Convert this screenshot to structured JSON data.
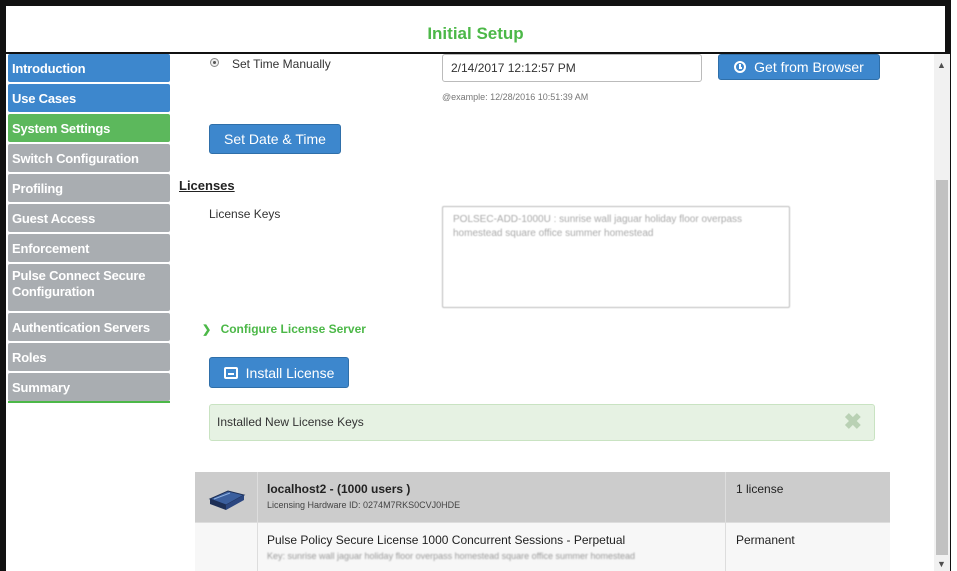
{
  "window": {
    "title": "Initial Setup"
  },
  "sidebar": {
    "items": [
      {
        "label": "Introduction",
        "state": "blue"
      },
      {
        "label": "Use Cases",
        "state": "blue"
      },
      {
        "label": "System Settings",
        "state": "green"
      },
      {
        "label": "Switch Configuration",
        "state": "grey"
      },
      {
        "label": "Profiling",
        "state": "grey"
      },
      {
        "label": "Guest Access",
        "state": "grey"
      },
      {
        "label": "Enforcement",
        "state": "grey"
      },
      {
        "label": "Pulse Connect Secure Configuration",
        "state": "grey"
      },
      {
        "label": "Authentication Servers",
        "state": "grey"
      },
      {
        "label": "Roles",
        "state": "grey"
      },
      {
        "label": "Summary",
        "state": "grey"
      }
    ]
  },
  "time": {
    "manual_label": "Set Time Manually",
    "value": "2/14/2017 12:12:57 PM",
    "example": "@example: 12/28/2016 10:51:39 AM",
    "browser_button": "Get from Browser",
    "set_button": "Set Date & Time"
  },
  "licenses": {
    "section_title": "Licenses",
    "keys_label": "License Keys",
    "keys_value": "POLSEC-ADD-1000U : sunrise wall jaguar holiday floor overpass homestead square office summer homestead",
    "configure_link": "Configure License Server",
    "install_button": "Install License",
    "alert_text": "Installed New License Keys",
    "alert_close": "✖"
  },
  "license_table": {
    "rows": [
      {
        "title": "localhost2 - (1000 users )",
        "subtitle": "Licensing Hardware ID: 0274M7RKS0CVJ0HDE",
        "right": "1 license",
        "kind": "device"
      },
      {
        "title": "Pulse Policy Secure License 1000 Concurrent Sessions - Perpetual",
        "subtitle": "Key: sunrise wall jaguar holiday floor overpass homestead square office summer homestead",
        "right": "Permanent",
        "kind": "license"
      }
    ]
  },
  "colors": {
    "title": "#4cb848",
    "nav_blue": "#3d87cd",
    "nav_green": "#5cb85c",
    "nav_grey": "#a9adb1",
    "button": "#3d87cd",
    "alert_bg": "#e6f2e3"
  },
  "icons": {
    "browser_button_icon": "clock-icon",
    "install_button_icon": "install-tray-icon",
    "configure_icon": "chevron-right-icon",
    "device_icon": "server-device-icon"
  }
}
